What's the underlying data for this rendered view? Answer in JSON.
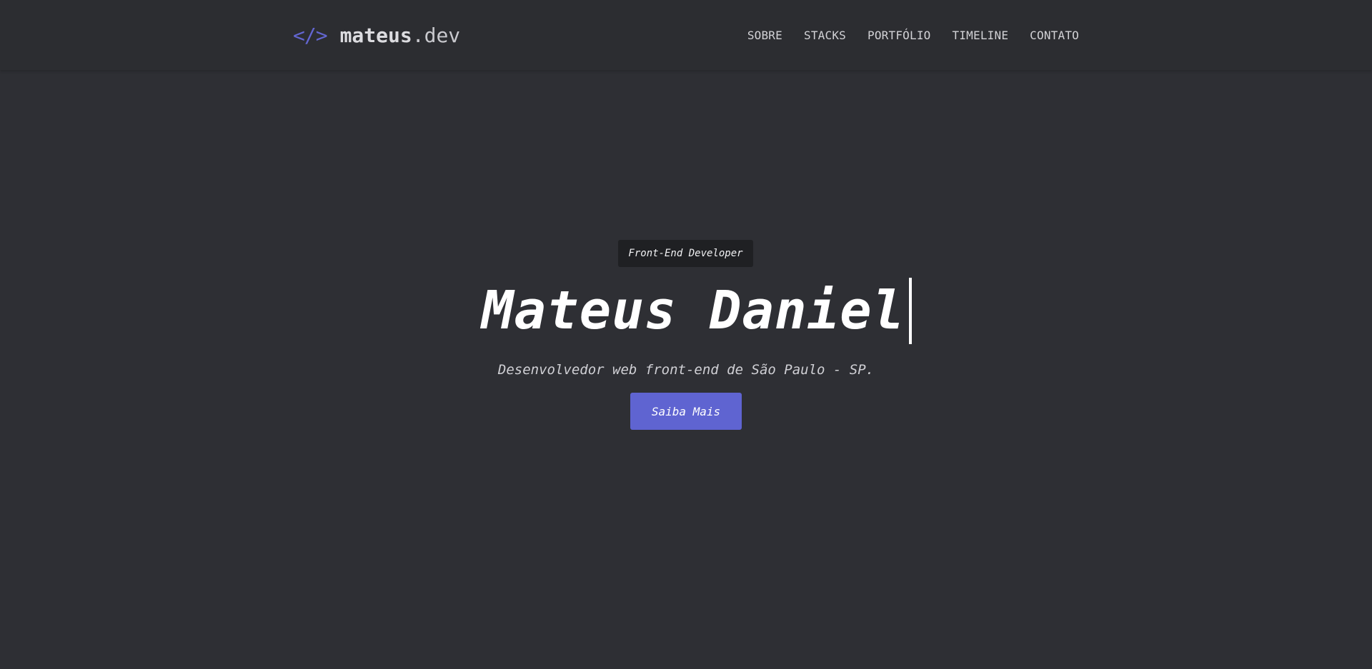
{
  "header": {
    "logo_icon": "</>",
    "logo_name": "mateus",
    "logo_tld": ".dev",
    "nav": [
      {
        "label": "SOBRE"
      },
      {
        "label": "STACKS"
      },
      {
        "label": "PORTFÓLIO"
      },
      {
        "label": "TIMELINE"
      },
      {
        "label": "CONTATO"
      }
    ]
  },
  "hero": {
    "badge": "Front-End Developer",
    "title": "Mateus Daniel",
    "subtitle": "Desenvolvedor web front-end de São Paulo - SP.",
    "cta_label": "Saiba Mais"
  },
  "colors": {
    "background": "#2e2f34",
    "header_background": "#2c2d31",
    "accent": "#5f64d1",
    "badge_background": "#1f2023",
    "text": "#ffffff"
  }
}
